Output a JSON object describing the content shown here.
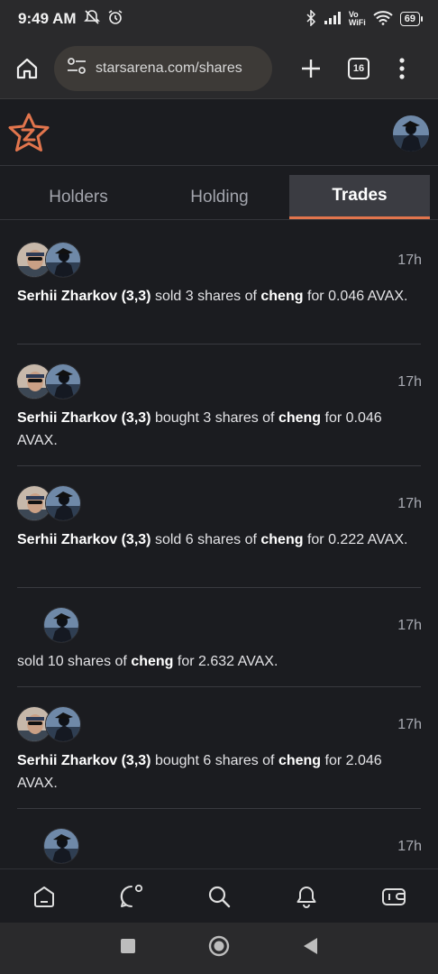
{
  "status_bar": {
    "time": "9:49 AM",
    "network_label_top": "Vo",
    "network_label_bottom": "WiFi",
    "battery": "69"
  },
  "browser": {
    "url": "starsarena.com/shares",
    "tab_count": "16"
  },
  "tabs": [
    {
      "label": "Holders",
      "active": false
    },
    {
      "label": "Holding",
      "active": false
    },
    {
      "label": "Trades",
      "active": true
    }
  ],
  "accent_color": "#e2754d",
  "trades": [
    {
      "trader": "Serhii Zharkov (3,3)",
      "action": "sold",
      "shares_text": "3 shares of",
      "subject": "cheng",
      "amount_text": "for 0.046",
      "line2": "AVAX.",
      "time": "17h"
    },
    {
      "trader": "Serhii Zharkov (3,3)",
      "action": "bought",
      "shares_text": "3 shares of",
      "subject": "cheng",
      "amount_text": "for 0.046",
      "line2": "AVAX.",
      "time": "17h"
    },
    {
      "trader": "Serhii Zharkov (3,3)",
      "action": "sold",
      "shares_text": "6 shares of",
      "subject": "cheng",
      "amount_text": "for 0.222",
      "line2": "AVAX.",
      "time": "17h"
    },
    {
      "trader": "",
      "action": "sold",
      "shares_text": "10 shares of",
      "subject": "cheng",
      "amount_text": "for 2.632 AVAX.",
      "line2": "",
      "time": "17h"
    },
    {
      "trader": "Serhii Zharkov (3,3)",
      "action": "bought",
      "shares_text": "6 shares of",
      "subject": "cheng",
      "amount_text": "for 2.046",
      "line2": "AVAX.",
      "time": "17h"
    },
    {
      "trader": "",
      "action": "",
      "shares_text": "",
      "subject": "",
      "amount_text": "",
      "line2": "",
      "time": "17h"
    }
  ],
  "bottom_nav": [
    "home-icon",
    "chat-icon",
    "search-icon",
    "bell-icon",
    "wallet-icon"
  ]
}
